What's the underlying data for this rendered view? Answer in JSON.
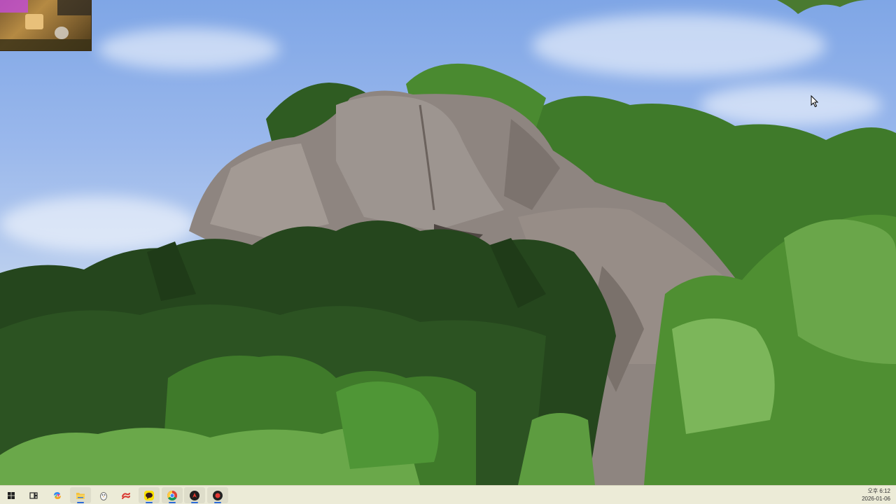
{
  "desktop": {
    "wallpaper_name": "rocky-hill-wallpaper"
  },
  "taskbar": {
    "background": "#ecebd7",
    "apps": [
      {
        "name": "start-button",
        "icon": "windows-logo-icon"
      },
      {
        "name": "task-view-button",
        "icon": "task-view-icon"
      },
      {
        "name": "copilot-button",
        "icon": "copilot-icon"
      },
      {
        "name": "file-explorer-button",
        "icon": "folder-icon"
      },
      {
        "name": "penguin-app-button",
        "icon": "penguin-icon"
      },
      {
        "name": "red-app-button",
        "icon": "swirl-icon"
      },
      {
        "name": "kakaotalk-button",
        "icon": "kakaotalk-icon"
      },
      {
        "name": "chrome-button",
        "icon": "chrome-icon"
      },
      {
        "name": "game-app-button",
        "icon": "game-icon"
      },
      {
        "name": "record-app-button",
        "icon": "record-icon"
      }
    ]
  },
  "clock": {
    "time": "오후 6:12",
    "date": "2026-01-06"
  }
}
